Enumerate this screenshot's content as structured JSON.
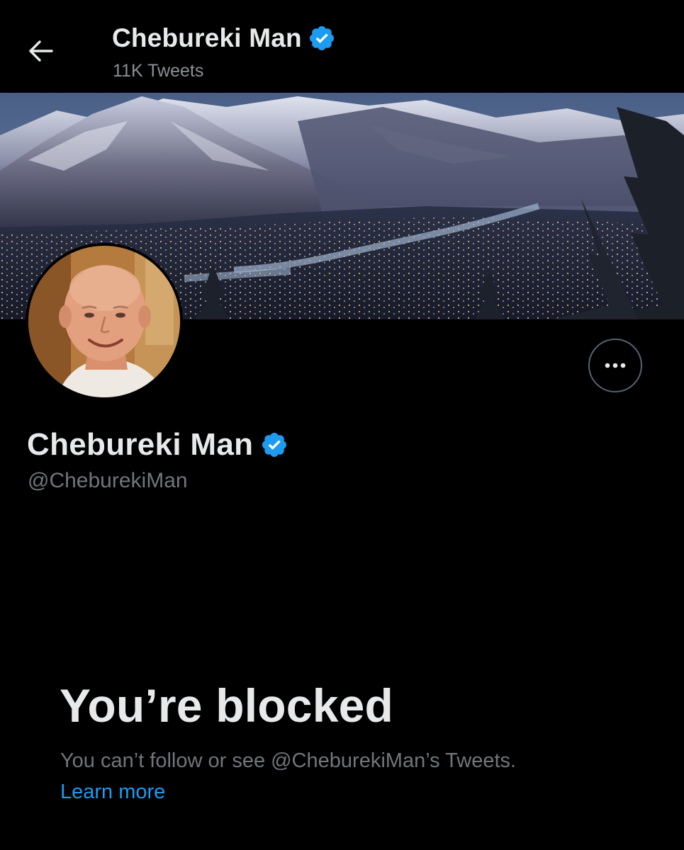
{
  "header": {
    "back_icon": "arrow-left-icon",
    "name": "Chebureki Man",
    "verified_icon": "verified-badge-icon",
    "tweet_count": "11K Tweets"
  },
  "banner": {
    "description_icon": "mountain-valley-night-banner"
  },
  "profile": {
    "name": "Chebureki Man",
    "handle": "@CheburekiMan",
    "verified_icon": "verified-badge-icon",
    "more_icon": "more-horizontal-icon"
  },
  "blocked": {
    "title": "You’re blocked",
    "description": "You can’t follow or see @CheburekiMan’s Tweets.",
    "learn_more": "Learn more"
  },
  "colors": {
    "background": "#000000",
    "text_primary": "#e7e9ea",
    "text_secondary": "#71767b",
    "accent": "#1d9bf0"
  }
}
